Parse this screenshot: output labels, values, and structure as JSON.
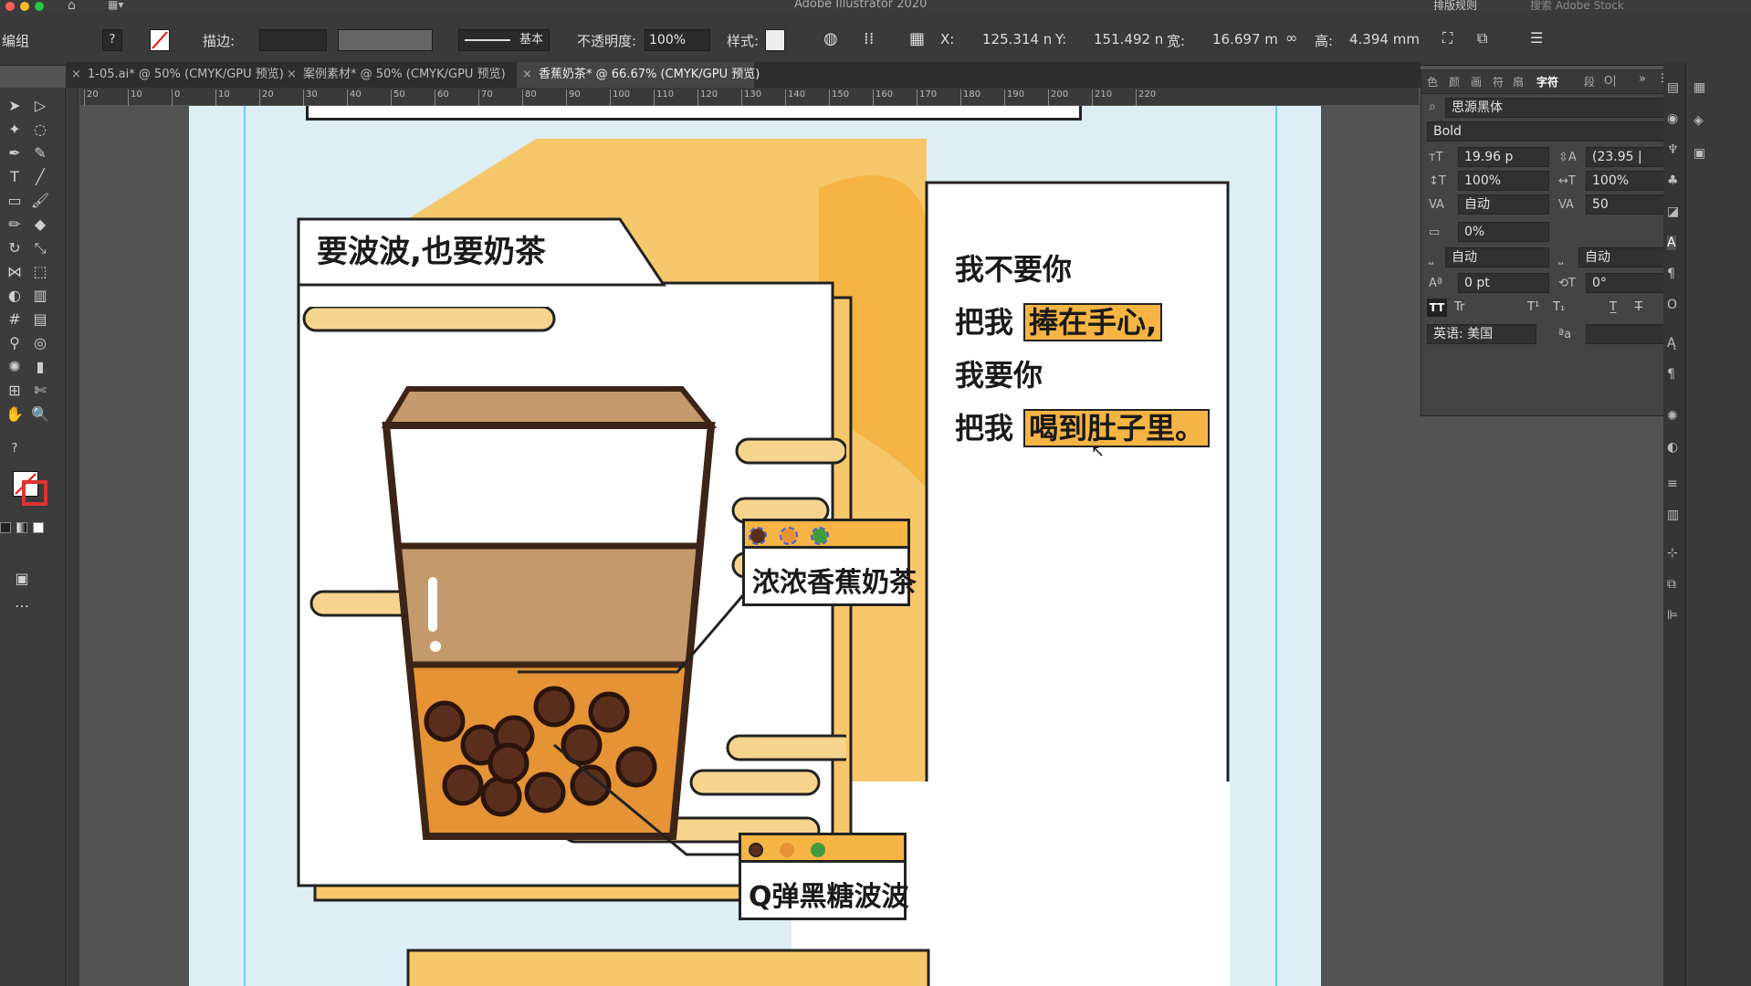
{
  "app": {
    "title": "Adobe Illustrator 2020",
    "workspace_label": "排版规则",
    "stock_search_placeholder": "搜索 Adobe Stock"
  },
  "control_bar": {
    "selection_label": "编组",
    "stroke_label": "描边:",
    "brush_value": "基本",
    "opacity_label": "不透明度:",
    "opacity_value": "100%",
    "style_label": "样式:",
    "x_label": "X:",
    "x_value": "125.314 n",
    "y_label": "Y:",
    "y_value": "151.492 n",
    "w_label": "宽:",
    "w_value": "16.697 m",
    "h_label": "高:",
    "h_value": "4.394 mm"
  },
  "tabs": [
    {
      "label": "1-05.ai* @ 50% (CMYK/GPU 预览)",
      "active": false
    },
    {
      "label": "案例素材* @ 50% (CMYK/GPU 预览)",
      "active": false
    },
    {
      "label": "香蕉奶茶* @ 66.67% (CMYK/GPU 预览)",
      "active": true
    }
  ],
  "ruler": {
    "ticks": [
      "20",
      "10",
      "0",
      "10",
      "20",
      "30",
      "40",
      "50",
      "60",
      "70",
      "80",
      "90",
      "100",
      "110",
      "120",
      "130",
      "140",
      "150",
      "160",
      "170",
      "180",
      "190",
      "200",
      "210",
      "220"
    ]
  },
  "artwork": {
    "headline": "要波波,也要奶茶",
    "lyrics": [
      {
        "text": "我不要你",
        "highlight": ""
      },
      {
        "text": "把我",
        "highlight": "捧在手心,"
      },
      {
        "text": "我要你",
        "highlight": ""
      },
      {
        "text": "把我",
        "highlight": "喝到肚子里。"
      }
    ],
    "label_tea": "浓浓香蕉奶茶",
    "label_boba": "Q弹黑糖波波",
    "colors": {
      "orange": "#f5b443",
      "light_orange": "#f6c76a",
      "cream": "#f7d48d",
      "brown": "#3d2418",
      "tan": "#c49a6c",
      "bg": "#ddeef5",
      "green": "#3f9c3f",
      "mid_orange": "#e59335"
    }
  },
  "character_panel": {
    "tabs": [
      "色",
      "颜",
      "画",
      "符",
      "扇",
      "字符",
      "段",
      "O|"
    ],
    "font_family": "思源黑体",
    "font_style": "Bold",
    "font_size": "19.96 p",
    "leading": "(23.95 |",
    "vertical_scale": "100%",
    "horizontal_scale": "100%",
    "kerning": "自动",
    "tracking": "50",
    "tsume": "0%",
    "aki_left": "自动",
    "aki_right": "自动",
    "baseline_shift": "0 pt",
    "rotation": "0°",
    "language": "英语: 美国"
  }
}
